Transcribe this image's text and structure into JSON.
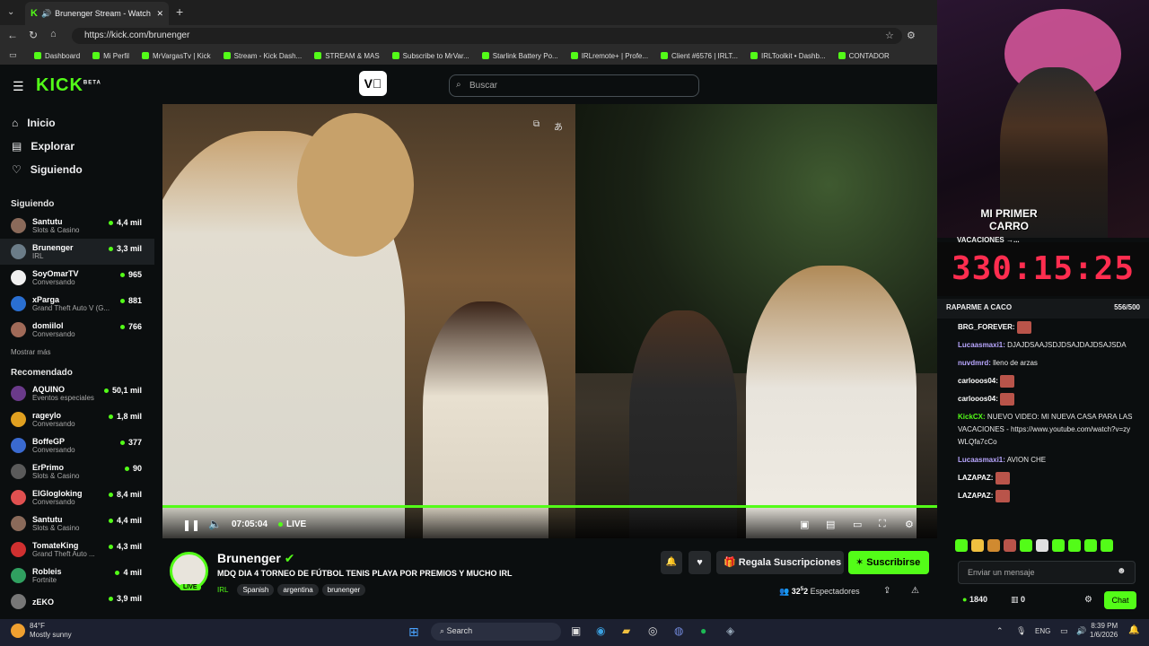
{
  "browser": {
    "tab_title": "Brunenger Stream - Watch Li...",
    "url": "https://kick.com/brunenger",
    "bookmarks": [
      "Dashboard",
      "Mi Perfil",
      "MrVargasTv | Kick",
      "Stream - Kick Dash...",
      "STREAM & MAS",
      "Subscribe to MrVar...",
      "Starlink Battery Po...",
      "IRLremote+ | Profe...",
      "Client #6576 | IRLT...",
      "IRLToolkit • Dashb...",
      "CONTADOR"
    ]
  },
  "kick": {
    "logo": "KICK",
    "beta": "BETA",
    "search_placeholder": "Buscar"
  },
  "sidebar": {
    "nav": [
      {
        "label": "Inicio",
        "icon": "home-icon"
      },
      {
        "label": "Explorar",
        "icon": "compass-icon"
      },
      {
        "label": "Siguiendo",
        "icon": "heart-icon"
      }
    ],
    "following_title": "Siguiendo",
    "following": [
      {
        "name": "Santutu",
        "cat": "Slots & Casino",
        "viewers": "4,4 mil",
        "color": "#8a6a5a"
      },
      {
        "name": "Brunenger",
        "cat": "IRL",
        "viewers": "3,3 mil",
        "color": "#6b7c88"
      },
      {
        "name": "SoyOmarTV",
        "cat": "Conversando",
        "viewers": "965",
        "color": "#f0f0f0"
      },
      {
        "name": "xParga",
        "cat": "Grand Theft Auto V (G...",
        "viewers": "881",
        "color": "#2a6fd1"
      },
      {
        "name": "domiilol",
        "cat": "Conversando",
        "viewers": "766",
        "color": "#a06a58"
      }
    ],
    "show_more": "Mostrar más",
    "recommended_title": "Recomendado",
    "recommended": [
      {
        "name": "AQUINO",
        "cat": "Eventos especiales",
        "viewers": "50,1 mil",
        "color": "#6a3a8a"
      },
      {
        "name": "rageylo",
        "cat": "Conversando",
        "viewers": "1,8 mil",
        "color": "#e0a020"
      },
      {
        "name": "BoffeGP",
        "cat": "Conversando",
        "viewers": "377",
        "color": "#3a6ad0"
      },
      {
        "name": "ErPrimo",
        "cat": "Slots & Casino",
        "viewers": "90",
        "color": "#5a5a5a"
      },
      {
        "name": "ElGlogloking",
        "cat": "Conversando",
        "viewers": "8,4 mil",
        "color": "#e05050"
      },
      {
        "name": "Santutu",
        "cat": "Slots & Casino",
        "viewers": "4,4 mil",
        "color": "#8a6a5a"
      },
      {
        "name": "TomateKing",
        "cat": "Grand Theft Auto ...",
        "viewers": "4,3 mil",
        "color": "#d03030"
      },
      {
        "name": "Robleis",
        "cat": "Fortnite",
        "viewers": "4 mil",
        "color": "#30a060"
      },
      {
        "name": "zEKO",
        "cat": "",
        "viewers": "3,9 mil",
        "color": "#777777"
      }
    ]
  },
  "player": {
    "time": "07:05:04",
    "live": "LIVE"
  },
  "stream": {
    "name": "Brunenger",
    "live_badge": "LIVE",
    "title": "MDQ DIA 4 TORNEO DE FÚTBOL TENIS PLAYA POR PREMIOS Y MUCHO IRL",
    "category": "IRL",
    "tags": [
      "Spanish",
      "argentina",
      "brunenger"
    ],
    "gift_label": "Regala Suscripciones",
    "subscribe_label": "Suscribirse",
    "viewers": "32",
    "viewers_sup": "5",
    "viewers_tail": "2",
    "viewers_label": "Espectadores"
  },
  "overlay": {
    "banner_line1": "MI PRIMER",
    "banner_line2": "CARRO",
    "timer": "330:15:25",
    "vacaciones": "VACACIONES →..."
  },
  "chat": {
    "goal_label": "RAPARME A CACO",
    "goal_progress": "556/500",
    "messages": [
      {
        "user": "BRG_FOREVER:",
        "text": "",
        "emote": true,
        "color": "#ffffff"
      },
      {
        "user": "Lucaasmaxi1:",
        "text": "DJAJDSAAJSDJDSAJDAJDSAJSDA",
        "emote": false,
        "color": "#b9a7ff"
      },
      {
        "user": "nuvdmrd:",
        "text": "lleno de arzas",
        "emote": false,
        "color": "#b9a7ff"
      },
      {
        "user": "carlooos04:",
        "text": "",
        "emote": true,
        "color": "#ffffff"
      },
      {
        "user": "carlooos04:",
        "text": "",
        "emote": true,
        "color": "#ffffff"
      },
      {
        "user": "KickCX:",
        "text": "NUEVO VIDEO: MI NUEVA CASA PARA LAS VACACIONES - https://www.youtube.com/watch?v=zyWLQfa7cCo",
        "emote": false,
        "color": "#53fc18"
      },
      {
        "user": "Lucaasmaxi1:",
        "text": "AVION CHE",
        "emote": false,
        "color": "#b9a7ff"
      },
      {
        "user": "LAZAPAZ:",
        "text": "",
        "emote": true,
        "color": "#ffffff"
      },
      {
        "user": "LAZAPAZ:",
        "text": "",
        "emote": true,
        "color": "#ffffff"
      }
    ],
    "input_placeholder": "Enviar un mensaje",
    "points": "1840",
    "sub_points": "0",
    "chat_button": "Chat"
  },
  "taskbar": {
    "temp": "84°F",
    "weather": "Mostly sunny",
    "search": "Search",
    "lang": "ENG",
    "time": "8:39 PM",
    "date": "1/6/2026"
  }
}
